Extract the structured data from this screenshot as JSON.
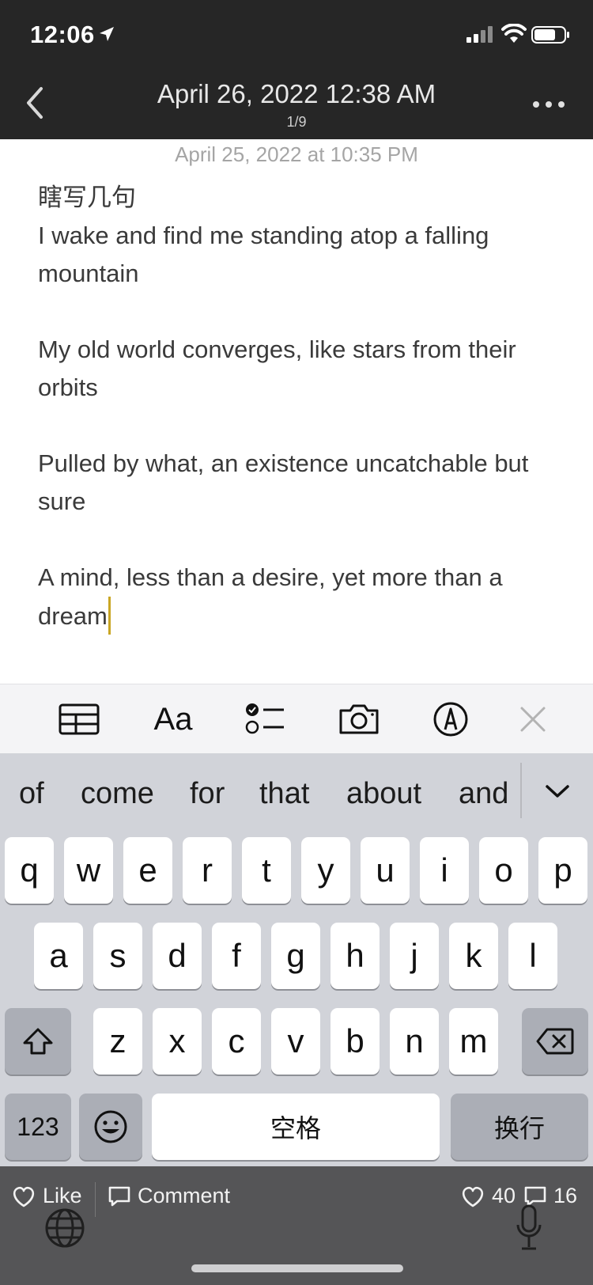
{
  "status": {
    "time": "12:06"
  },
  "nav": {
    "title": "April 26, 2022 12:38 AM",
    "counter": "1/9"
  },
  "note": {
    "date": "April 25, 2022 at 10:35 PM",
    "lines": [
      "瞎写几句",
      "I wake and find me standing atop a falling mountain",
      "My old world converges, like stars from their orbits",
      "Pulled by what, an existence uncatchable but sure",
      "A mind, less than a desire, yet more than a dream"
    ]
  },
  "toolbar": {
    "items": [
      "table-icon",
      "text-format-icon",
      "checklist-icon",
      "camera-icon",
      "markup-icon",
      "close-icon"
    ],
    "format_label": "Aa"
  },
  "keyboard": {
    "suggestions": [
      "of",
      "come",
      "for",
      "that",
      "about",
      "and"
    ],
    "row1": [
      "q",
      "w",
      "e",
      "r",
      "t",
      "y",
      "u",
      "i",
      "o",
      "p"
    ],
    "row2": [
      "a",
      "s",
      "d",
      "f",
      "g",
      "h",
      "j",
      "k",
      "l"
    ],
    "row3": [
      "z",
      "x",
      "c",
      "v",
      "b",
      "n",
      "m"
    ],
    "numbers_key": "123",
    "space_key": "空格",
    "return_key": "换行"
  },
  "bottom": {
    "like_label": "Like",
    "comment_label": "Comment",
    "like_count": "40",
    "comment_count": "16"
  },
  "colors": {
    "topbar": "#262626",
    "caret": "#c9a624",
    "keyboard_bg": "#d1d3d9",
    "bottombar": "#555557"
  }
}
